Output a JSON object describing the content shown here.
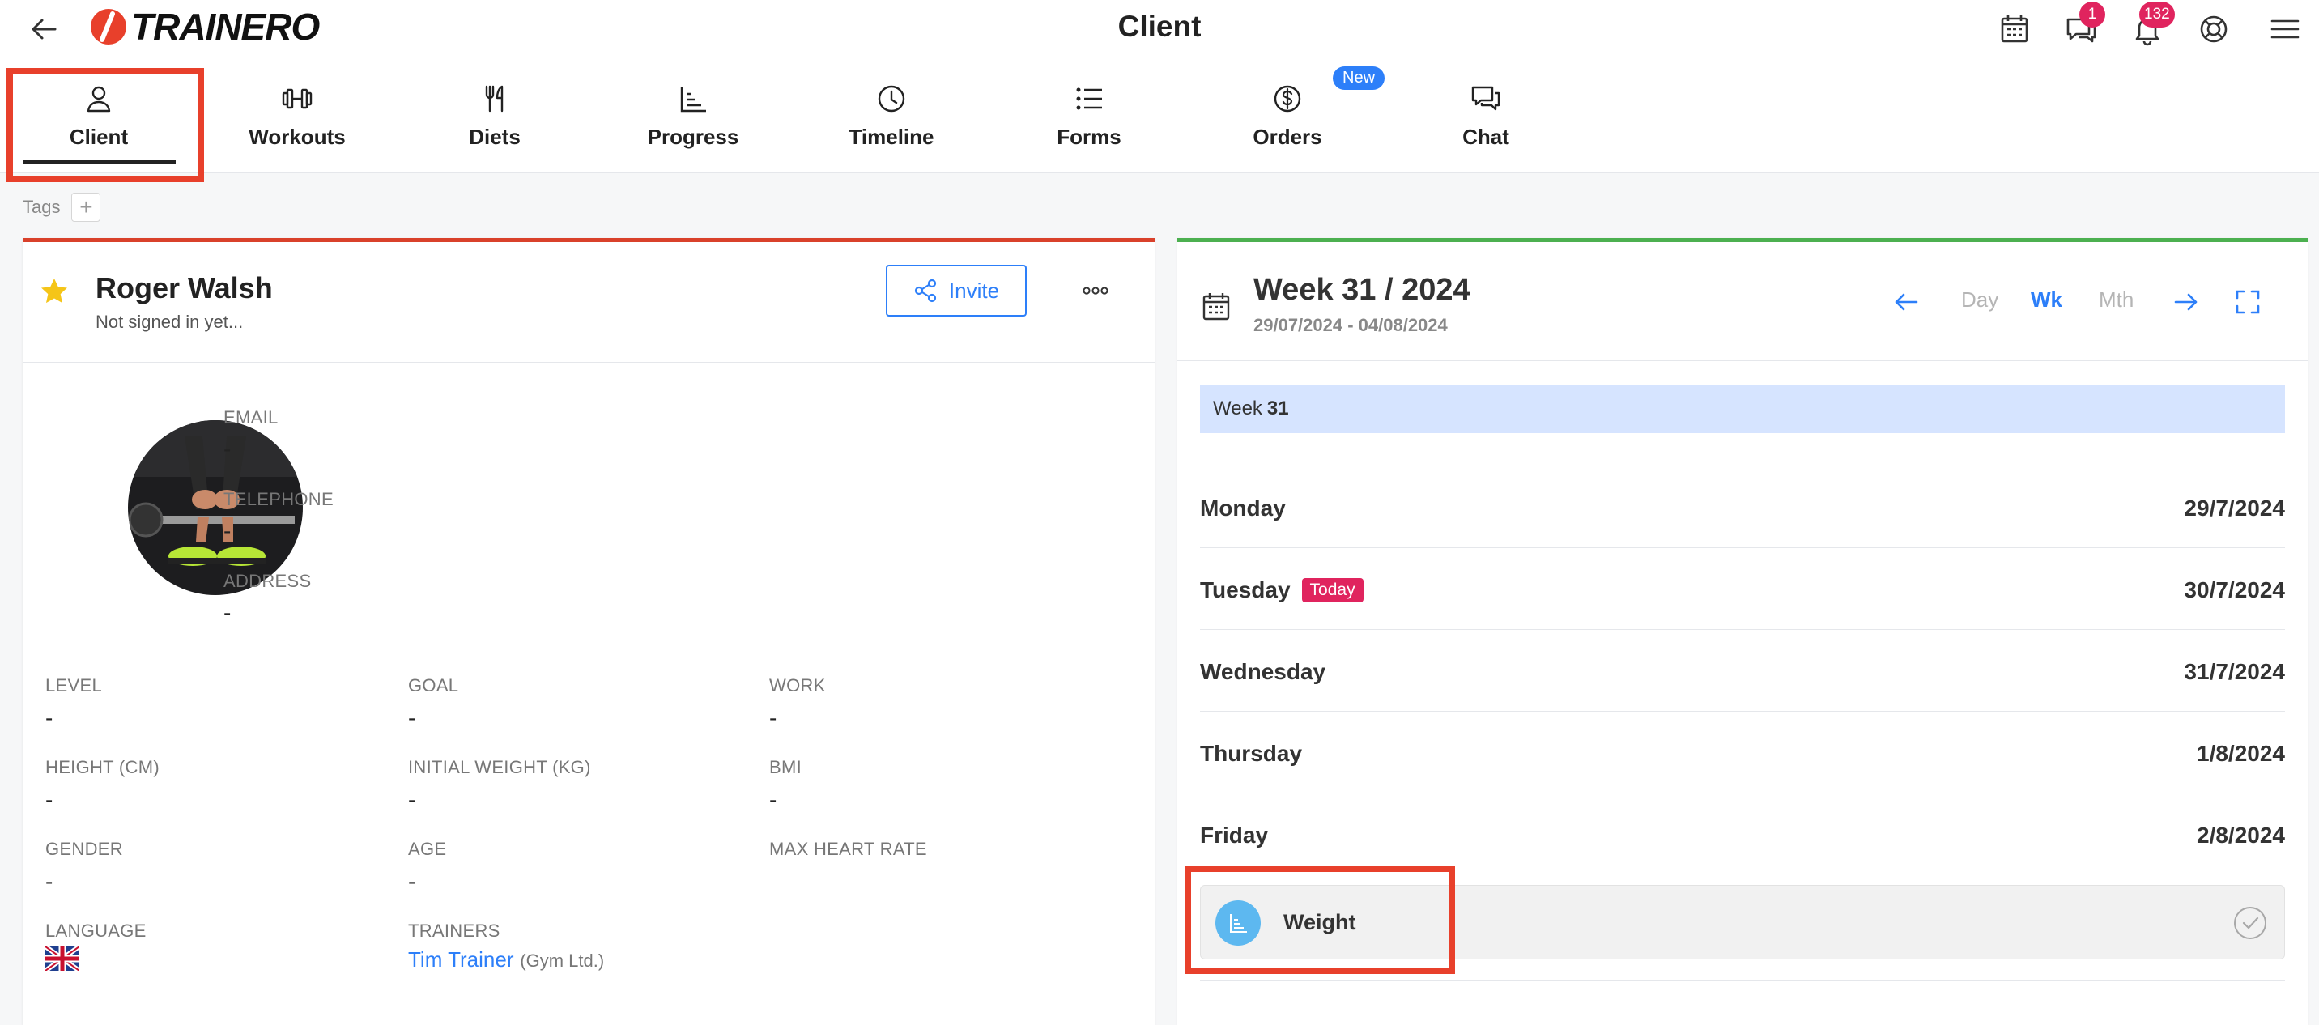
{
  "app": {
    "brand": "TRAINERO",
    "page_title": "Client"
  },
  "header": {
    "messages_badge": "1",
    "notifications_badge": "132"
  },
  "tabs": [
    {
      "label": "Client",
      "icon": "user-icon",
      "active": true
    },
    {
      "label": "Workouts",
      "icon": "dumbbell-icon"
    },
    {
      "label": "Diets",
      "icon": "fork-knife-icon"
    },
    {
      "label": "Progress",
      "icon": "chart-icon"
    },
    {
      "label": "Timeline",
      "icon": "clock-icon"
    },
    {
      "label": "Forms",
      "icon": "list-icon"
    },
    {
      "label": "Orders",
      "icon": "dollar-icon",
      "badge": "New"
    },
    {
      "label": "Chat",
      "icon": "chat-icon"
    }
  ],
  "tags": {
    "label": "Tags",
    "add": "+"
  },
  "client": {
    "name": "Roger Walsh",
    "status": "Not signed in yet...",
    "invite_label": "Invite",
    "fields": {
      "email": {
        "label": "EMAIL",
        "value": "-"
      },
      "telephone": {
        "label": "TELEPHONE",
        "value": "-"
      },
      "address": {
        "label": "ADDRESS",
        "value": "-"
      },
      "level": {
        "label": "LEVEL",
        "value": "-"
      },
      "goal": {
        "label": "GOAL",
        "value": "-"
      },
      "work": {
        "label": "WORK",
        "value": "-"
      },
      "height": {
        "label": "HEIGHT (CM)",
        "value": "-"
      },
      "initial_weight": {
        "label": "INITIAL WEIGHT (KG)",
        "value": "-"
      },
      "bmi": {
        "label": "BMI",
        "value": "-"
      },
      "gender": {
        "label": "GENDER",
        "value": "-"
      },
      "age": {
        "label": "AGE",
        "value": "-"
      },
      "max_heart_rate": {
        "label": "MAX HEART RATE",
        "value": ""
      },
      "language": {
        "label": "LANGUAGE"
      },
      "trainers": {
        "label": "TRAINERS",
        "name": "Tim Trainer",
        "org": "(Gym Ltd.)"
      }
    }
  },
  "calendar": {
    "title": "Week 31 / 2024",
    "range": "29/07/2024 - 04/08/2024",
    "views": {
      "day": "Day",
      "week": "Wk",
      "month": "Mth"
    },
    "week_bar": {
      "prefix": "Week",
      "number": "31"
    },
    "days": [
      {
        "name": "Monday",
        "date": "29/7/2024"
      },
      {
        "name": "Tuesday",
        "date": "30/7/2024",
        "badge": "Today"
      },
      {
        "name": "Wednesday",
        "date": "31/7/2024"
      },
      {
        "name": "Thursday",
        "date": "1/8/2024"
      },
      {
        "name": "Friday",
        "date": "2/8/2024"
      }
    ],
    "task": {
      "label": "Weight"
    }
  },
  "colors": {
    "accent": "#2d7ff9",
    "brand_red": "#e8402b",
    "left_card_top": "#d9412b",
    "right_card_top": "#4cb050",
    "today": "#e0245e",
    "week_bar": "#d6e4ff"
  }
}
